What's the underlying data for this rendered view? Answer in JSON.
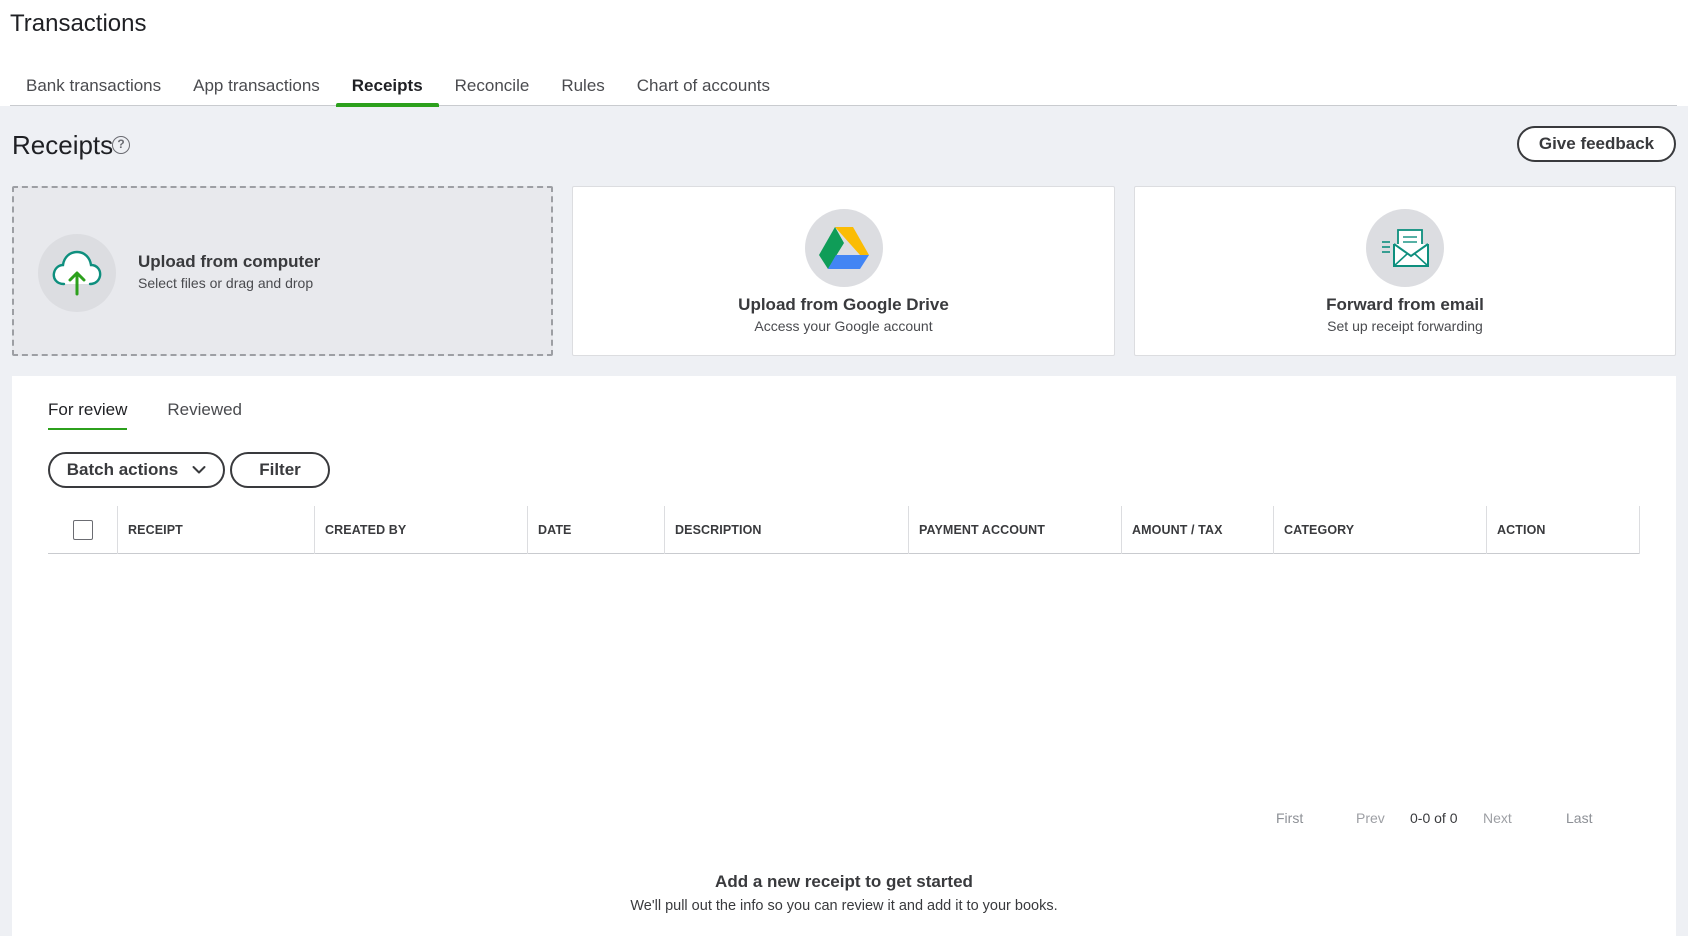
{
  "page_title": "Transactions",
  "tabs": [
    {
      "label": "Bank transactions"
    },
    {
      "label": "App transactions"
    },
    {
      "label": "Receipts"
    },
    {
      "label": "Reconcile"
    },
    {
      "label": "Rules"
    },
    {
      "label": "Chart of accounts"
    }
  ],
  "active_tab": "Receipts",
  "receipts": {
    "title": "Receipts",
    "help_symbol": "?",
    "feedback_label": "Give feedback"
  },
  "cards": {
    "upload": {
      "title": "Upload from computer",
      "subtitle": "Select files or drag and drop"
    },
    "gdrive": {
      "title": "Upload from Google Drive",
      "subtitle": "Access your Google account"
    },
    "email": {
      "title": "Forward from email",
      "subtitle": "Set up receipt forwarding"
    }
  },
  "review_tabs": [
    {
      "label": "For review"
    },
    {
      "label": "Reviewed"
    }
  ],
  "toolbar": {
    "batch_label": "Batch actions",
    "filter_label": "Filter"
  },
  "table": {
    "columns": [
      "RECEIPT",
      "CREATED BY",
      "DATE",
      "DESCRIPTION",
      "PAYMENT ACCOUNT",
      "AMOUNT / TAX",
      "CATEGORY",
      "ACTION"
    ]
  },
  "pager": {
    "first": "First",
    "prev": "Prev",
    "info": "0-0 of 0",
    "next": "Next",
    "last": "Last"
  },
  "empty_state": {
    "title": "Add a new receipt to get started",
    "subtitle": "We'll pull out the info so you can review it and add it to your books."
  },
  "colors": {
    "accent": "#2ca01c",
    "background": "#eef0f4"
  }
}
